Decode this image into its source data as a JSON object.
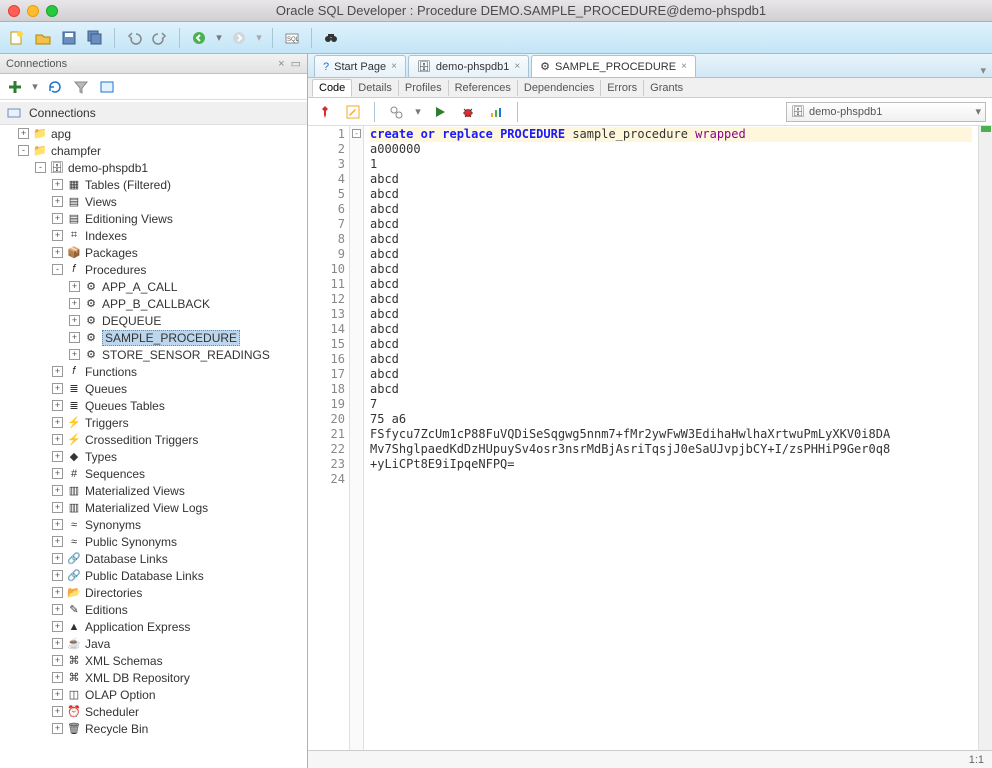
{
  "window": {
    "title": "Oracle SQL Developer : Procedure DEMO.SAMPLE_PROCEDURE@demo-phspdb1"
  },
  "sidebar": {
    "title": "Connections",
    "root": "Connections",
    "nodes": {
      "apg": "apg",
      "champfer": "champfer",
      "conn": "demo-phspdb1",
      "tables": "Tables (Filtered)",
      "views": "Views",
      "edviews": "Editioning Views",
      "indexes": "Indexes",
      "packages": "Packages",
      "procedures": "Procedures",
      "p1": "APP_A_CALL",
      "p2": "APP_B_CALLBACK",
      "p3": "DEQUEUE",
      "p4": "SAMPLE_PROCEDURE",
      "p5": "STORE_SENSOR_READINGS",
      "functions": "Functions",
      "queues": "Queues",
      "queuestables": "Queues Tables",
      "triggers": "Triggers",
      "crosstriggers": "Crossedition Triggers",
      "types": "Types",
      "sequences": "Sequences",
      "matviews": "Materialized Views",
      "matviewlogs": "Materialized View Logs",
      "synonyms": "Synonyms",
      "pubsynonyms": "Public Synonyms",
      "dblinks": "Database Links",
      "pubdblinks": "Public Database Links",
      "directories": "Directories",
      "editions": "Editions",
      "apex": "Application Express",
      "java": "Java",
      "xmlschemas": "XML Schemas",
      "xmldb": "XML DB Repository",
      "olap": "OLAP Option",
      "scheduler": "Scheduler",
      "recyclebin": "Recycle Bin"
    }
  },
  "tabs": {
    "start": "Start Page",
    "conn": "demo-phspdb1",
    "proc": "SAMPLE_PROCEDURE"
  },
  "subtabs": {
    "code": "Code",
    "details": "Details",
    "profiles": "Profiles",
    "references": "References",
    "dependencies": "Dependencies",
    "errors": "Errors",
    "grants": "Grants"
  },
  "combo": {
    "label": "demo-phspdb1"
  },
  "editor": {
    "position": "1:1",
    "lines": [
      {
        "n": 1,
        "html": "<span class='kw'>create or replace</span> <span class='kw'>PROCEDURE</span> sample_procedure <span class='kw2'>wrapped</span>"
      },
      {
        "n": 2,
        "text": "a000000"
      },
      {
        "n": 3,
        "text": "1"
      },
      {
        "n": 4,
        "text": "abcd"
      },
      {
        "n": 5,
        "text": "abcd"
      },
      {
        "n": 6,
        "text": "abcd"
      },
      {
        "n": 7,
        "text": "abcd"
      },
      {
        "n": 8,
        "text": "abcd"
      },
      {
        "n": 9,
        "text": "abcd"
      },
      {
        "n": 10,
        "text": "abcd"
      },
      {
        "n": 11,
        "text": "abcd"
      },
      {
        "n": 12,
        "text": "abcd"
      },
      {
        "n": 13,
        "text": "abcd"
      },
      {
        "n": 14,
        "text": "abcd"
      },
      {
        "n": 15,
        "text": "abcd"
      },
      {
        "n": 16,
        "text": "abcd"
      },
      {
        "n": 17,
        "text": "abcd"
      },
      {
        "n": 18,
        "text": "abcd"
      },
      {
        "n": 19,
        "text": "7"
      },
      {
        "n": 20,
        "text": "75 a6"
      },
      {
        "n": 21,
        "text": "FSfycu7ZcUm1cP88FuVQDiSeSqgwg5nnm7+fMr2ywFwW3EdihaHwlhaXrtwuPmLyXKV0i8DA"
      },
      {
        "n": 22,
        "text": "Mv7ShglpaedKdDzHUpuySv4osr3nsrMdBjAsriTqsjJ0eSaUJvpjbCY+I/zsPHHiP9Ger0q8"
      },
      {
        "n": 23,
        "text": "+yLiCPt8E9iIpqeNFPQ="
      },
      {
        "n": 24,
        "text": ""
      }
    ]
  }
}
